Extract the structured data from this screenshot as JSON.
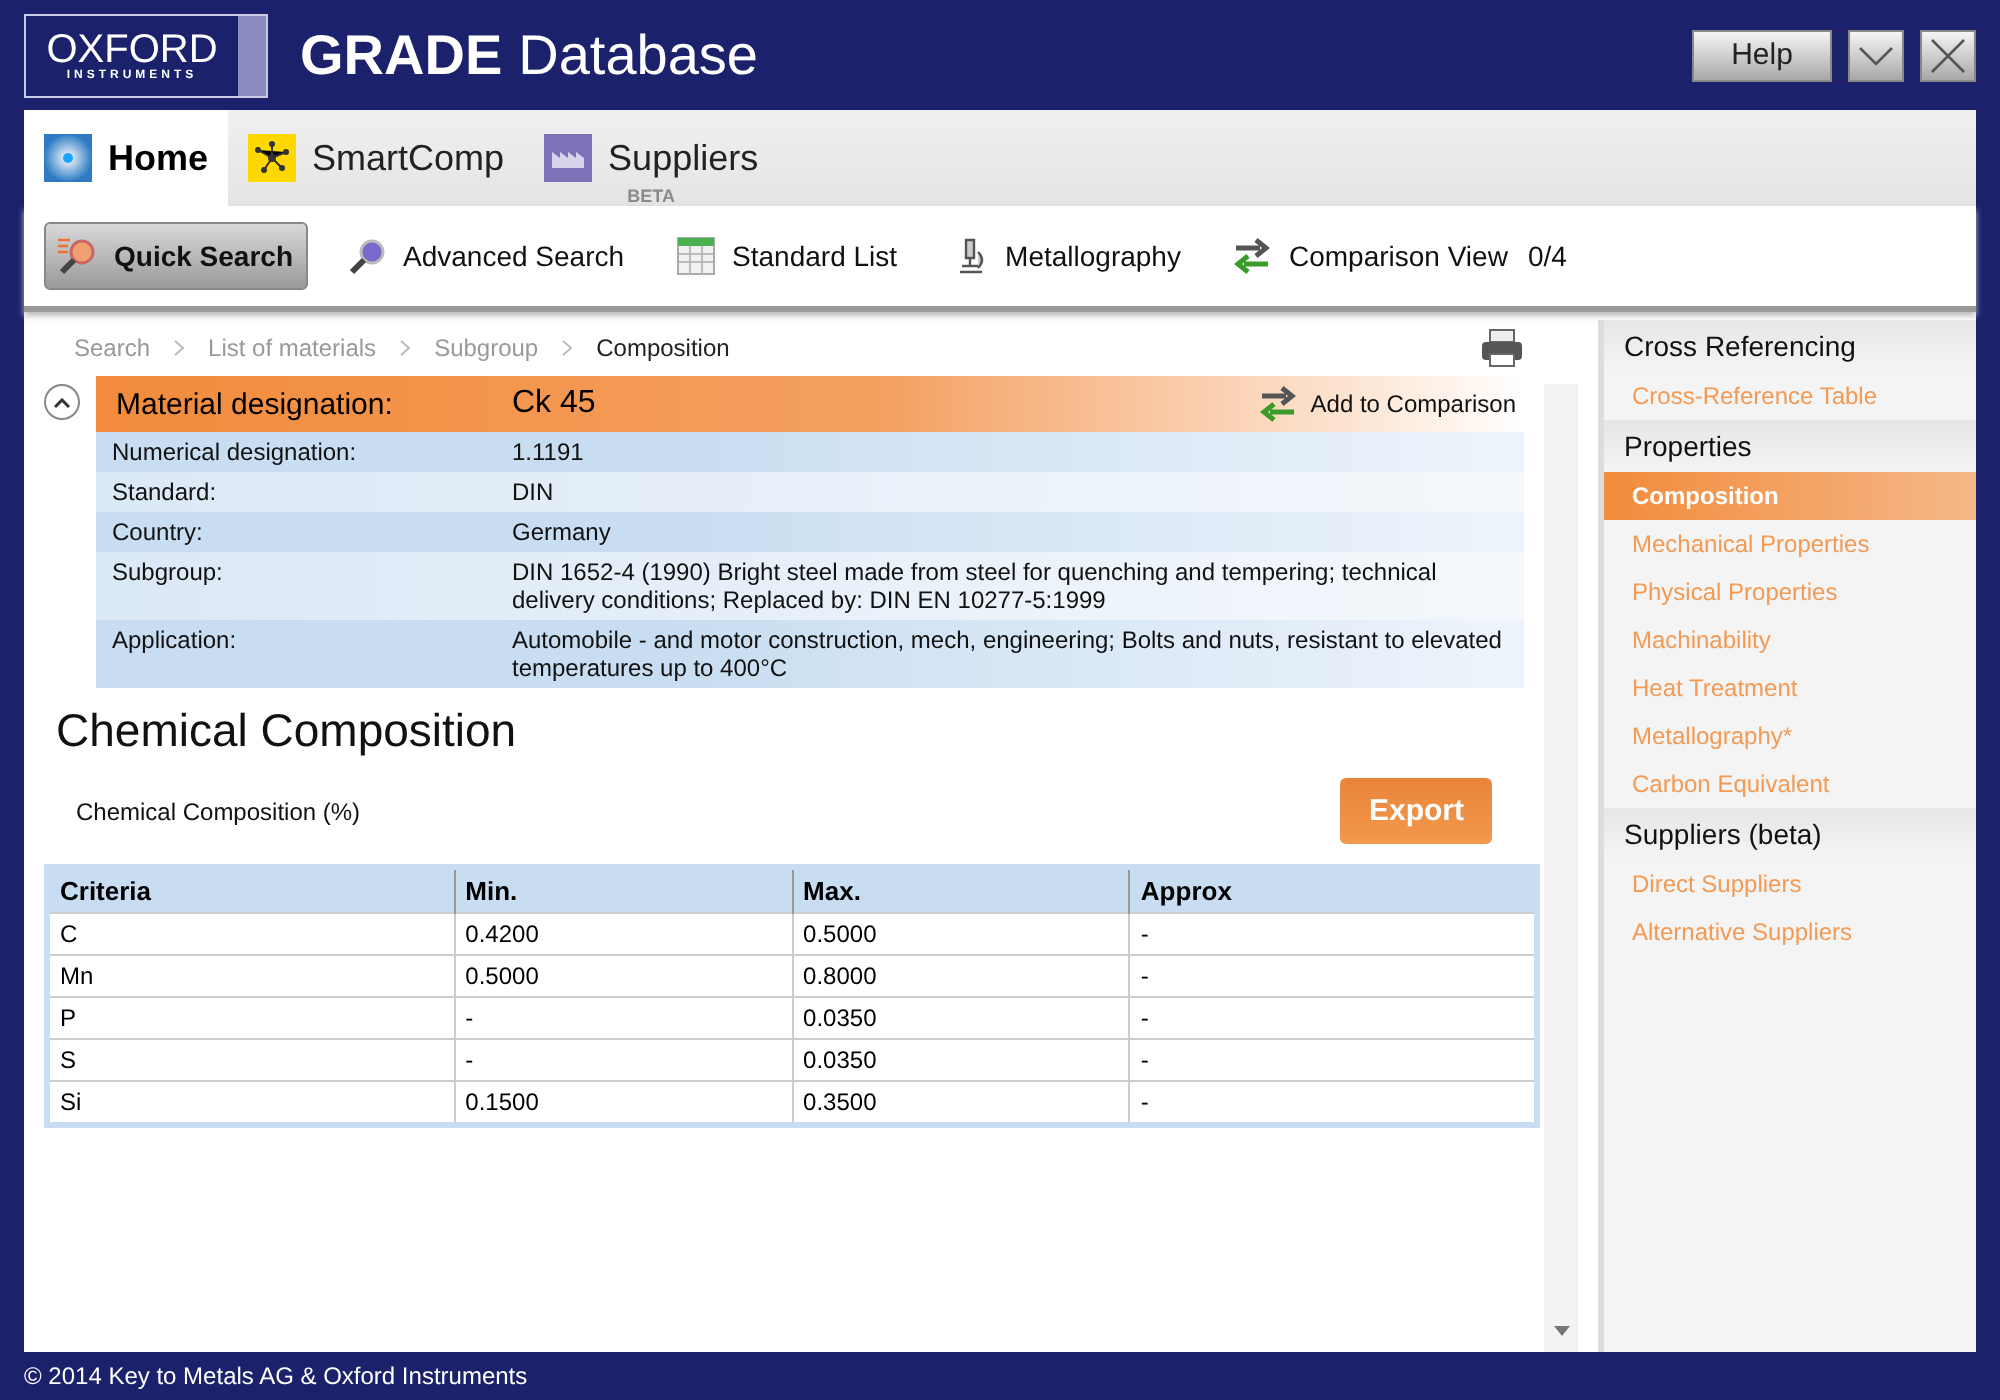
{
  "window": {
    "logo": {
      "line_1": "OXFORD",
      "line_2": "INSTRUMENTS"
    },
    "title_bold": "GRADE",
    "title": "Database"
  },
  "header_buttons": [
    {
      "kind": "help",
      "label": "Help"
    },
    {
      "kind": "minimize"
    },
    {
      "kind": "close"
    }
  ],
  "tabs": [
    {
      "kind": "home",
      "label": "Home",
      "selected": true
    },
    {
      "kind": "smartcomp",
      "label": "SmartComp",
      "selected": false
    },
    {
      "kind": "suppliers",
      "label": "Suppliers",
      "badge": "BETA",
      "selected": false
    }
  ],
  "toolbar": [
    {
      "kind": "quick-search",
      "label": "Quick Search",
      "selected": true
    },
    {
      "kind": "advanced-search",
      "label": "Advanced Search",
      "selected": false
    },
    {
      "kind": "standard-list",
      "label": "Standard List",
      "selected": false
    },
    {
      "kind": "metallography",
      "label": "Metallography",
      "selected": false
    },
    {
      "kind": "comparison",
      "label": "Comparison View",
      "count": "0/4",
      "selected": false
    }
  ],
  "breadcrumb": [
    {
      "label": "Search",
      "current": false
    },
    {
      "label": "List of materials",
      "current": false
    },
    {
      "label": "Subgroup",
      "current": false
    },
    {
      "label": "Composition",
      "current": true
    }
  ],
  "material": {
    "expanded": true,
    "label": "Material designation:",
    "value": "Ck 45",
    "action": "Add to Comparison",
    "rows": [
      {
        "label": "Numerical designation:",
        "value": "1.1191"
      },
      {
        "label": "Standard:",
        "value": "DIN"
      },
      {
        "label": "Country:",
        "value": "Germany"
      },
      {
        "label": "Subgroup:",
        "value": "DIN 1652-4 (1990) Bright steel made from steel for quenching and tempering; technical delivery conditions; Replaced by: DIN EN 10277-5:1999"
      },
      {
        "label": "Application:",
        "value": "Automobile - and motor construction, mech, engineering; Bolts and nuts, resistant to elevated temperatures up to 400°C"
      }
    ]
  },
  "section_title": "Chemical Composition",
  "caption": "Chemical Composition (%)",
  "export_button": "Export",
  "table": {
    "columns": [
      "Criteria",
      "Min.",
      "Max.",
      "Approx"
    ],
    "rows": [
      [
        "C",
        "0.4200",
        "0.5000",
        "-"
      ],
      [
        "Mn",
        "0.5000",
        "0.8000",
        "-"
      ],
      [
        "P",
        "-",
        "0.0350",
        "-"
      ],
      [
        "S",
        "-",
        "0.0350",
        "-"
      ],
      [
        "Si",
        "0.1500",
        "0.3500",
        "-"
      ]
    ]
  },
  "sidebar": [
    {
      "title": "Cross Referencing",
      "items": [
        {
          "label": "Cross-Reference Table",
          "selected": false
        }
      ]
    },
    {
      "title": "Properties",
      "items": [
        {
          "label": "Composition",
          "selected": true
        },
        {
          "label": "Mechanical Properties",
          "selected": false
        },
        {
          "label": "Physical Properties",
          "selected": false
        },
        {
          "label": "Machinability",
          "selected": false
        },
        {
          "label": "Heat Treatment",
          "selected": false
        },
        {
          "label": "Metallography*",
          "selected": false
        },
        {
          "label": "Carbon Equivalent",
          "selected": false
        }
      ]
    },
    {
      "title": "Suppliers (beta)",
      "items": [
        {
          "label": "Direct Suppliers",
          "selected": false
        },
        {
          "label": "Alternative Suppliers",
          "selected": false
        }
      ]
    }
  ],
  "status_bar": "© 2014 Key to Metals AG & Oxford Instruments"
}
